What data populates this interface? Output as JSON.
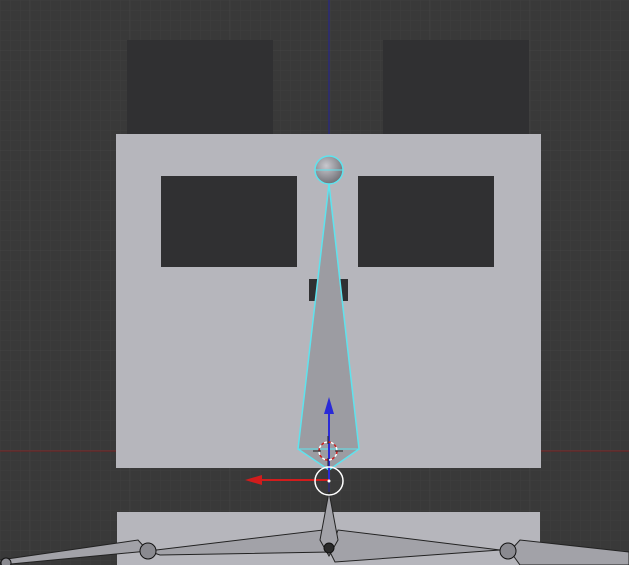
{
  "viewport": {
    "background": "#393939",
    "grid_minor_color": "#3e3e3e",
    "grid_major_color": "#444444"
  },
  "colors": {
    "mesh_light": "#b6b6bc",
    "mesh_dark": "#303032",
    "bone_fill": "#9c9ca2",
    "bone_selected_outline": "#5ee3ee",
    "axis_x": "#7a2020",
    "axis_z": "#23239a",
    "gizmo_x": "#d21c1c",
    "gizmo_z": "#2a2ad8",
    "gizmo_ring": "#ffffff",
    "cursor_red": "#d21c1c",
    "cursor_white": "#ffffff"
  },
  "icons": {
    "cursor": "3d-cursor-icon",
    "gizmo": "transform-gizmo-icon",
    "joint": "bone-joint-icon"
  }
}
